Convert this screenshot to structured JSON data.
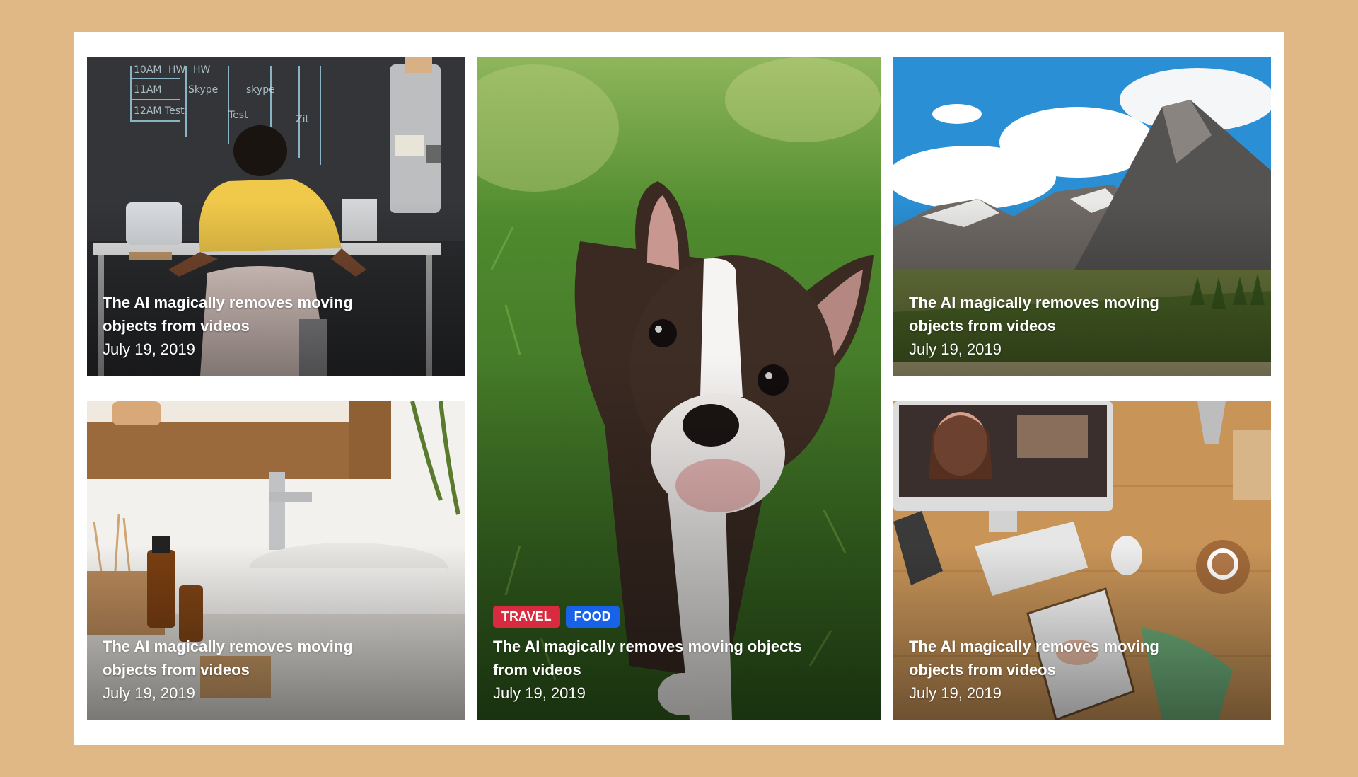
{
  "colors": {
    "page_background": "#e0b886",
    "panel_background": "#ffffff",
    "tag_travel": "#d92b3f",
    "tag_food": "#1862e8"
  },
  "posts": [
    {
      "title": "The AI magically removes moving objects from videos",
      "date": "July 19, 2019",
      "image": "person-working-at-chalkboard-desk"
    },
    {
      "title": "The AI magically removes moving objects from videos",
      "date": "July 19, 2019",
      "image": "boston-terrier-puppy-on-grass",
      "tags": [
        {
          "label": "TRAVEL",
          "color": "#d92b3f"
        },
        {
          "label": "FOOD",
          "color": "#1862e8"
        }
      ]
    },
    {
      "title": "The AI magically removes moving objects from videos",
      "date": "July 19, 2019",
      "image": "mountain-landscape"
    },
    {
      "title": "The AI magically removes moving objects from videos",
      "date": "July 19, 2019",
      "image": "bathroom-sink"
    },
    {
      "title": "The AI magically removes moving objects from videos",
      "date": "July 19, 2019",
      "image": "desk-with-computer-and-notebook"
    }
  ]
}
